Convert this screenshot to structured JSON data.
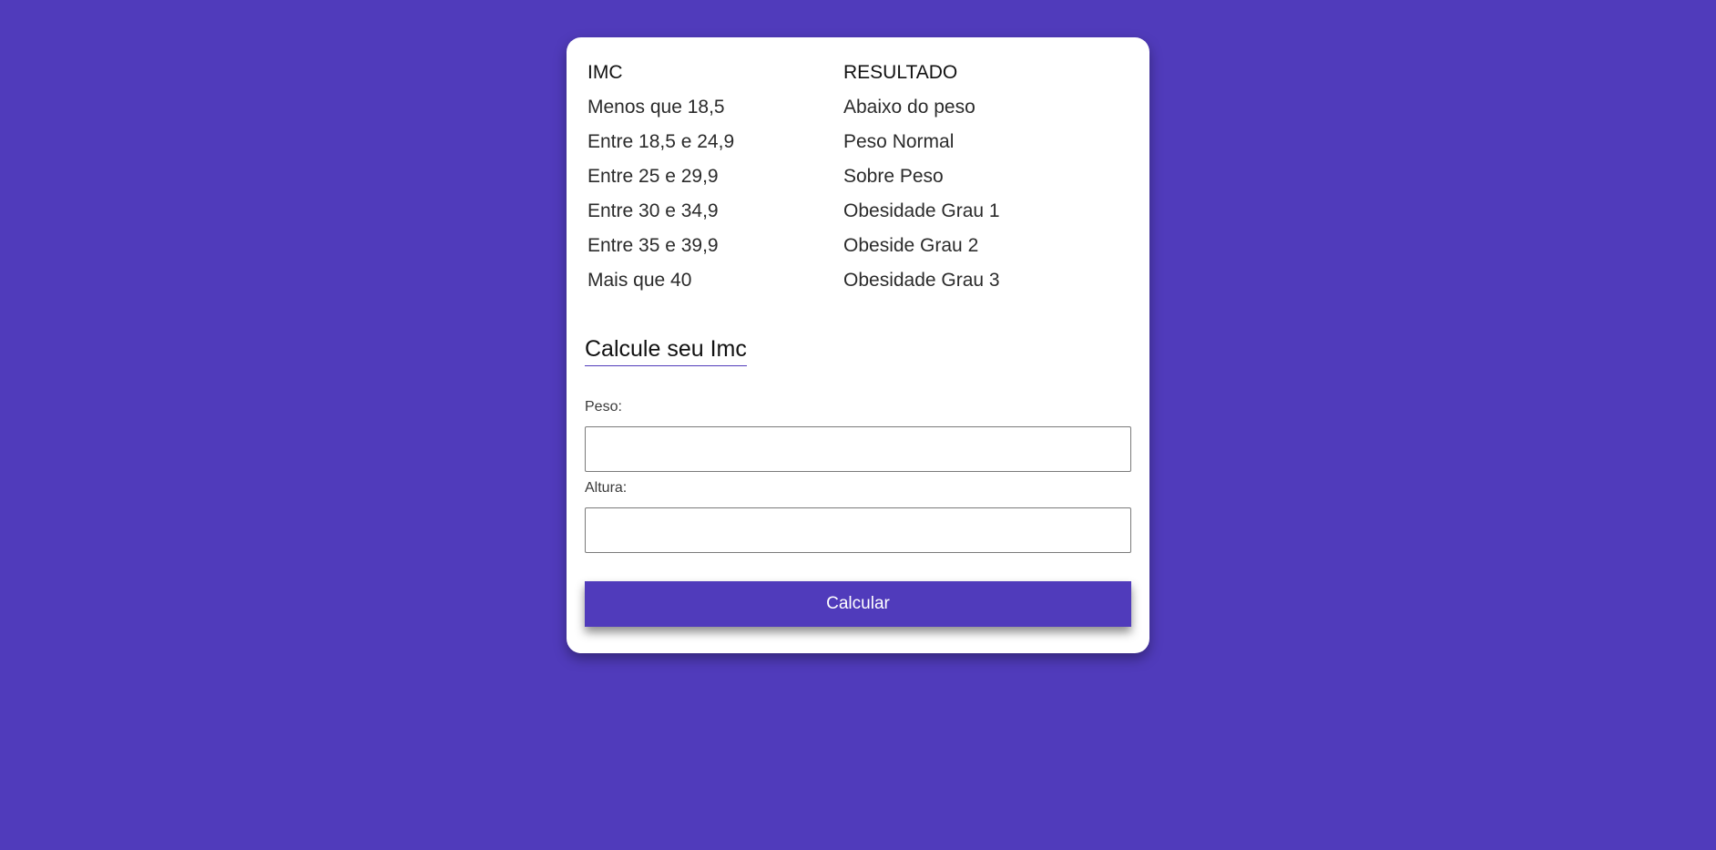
{
  "colors": {
    "background": "#503bbb",
    "card": "#ffffff",
    "button": "#503bbb",
    "button_text": "#ffffff"
  },
  "table": {
    "header": {
      "imc": "IMC",
      "result": "RESULTADO"
    },
    "rows": [
      {
        "imc": "Menos que 18,5",
        "result": "Abaixo do peso"
      },
      {
        "imc": "Entre 18,5 e 24,9",
        "result": "Peso Normal"
      },
      {
        "imc": "Entre 25 e 29,9",
        "result": "Sobre Peso"
      },
      {
        "imc": "Entre 30 e 34,9",
        "result": "Obesidade Grau 1"
      },
      {
        "imc": "Entre 35 e 39,9",
        "result": "Obeside Grau 2"
      },
      {
        "imc": "Mais que 40",
        "result": "Obesidade Grau 3"
      }
    ]
  },
  "form": {
    "title": "Calcule seu Imc",
    "peso_label": "Peso:",
    "peso_value": "",
    "altura_label": "Altura:",
    "altura_value": "",
    "button_label": "Calcular"
  }
}
